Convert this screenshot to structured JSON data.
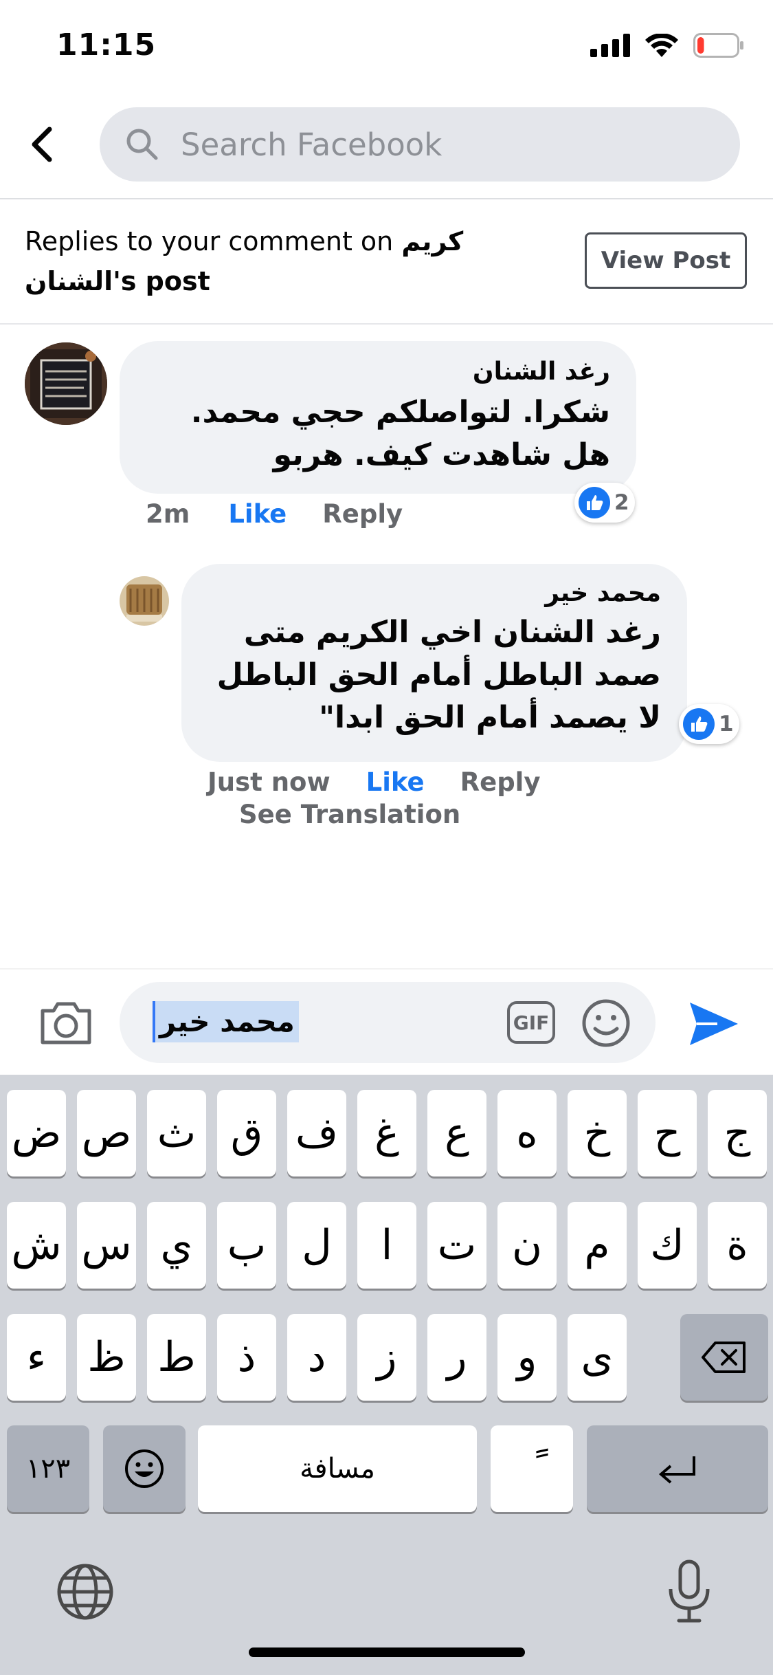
{
  "status_bar": {
    "time": "11:15",
    "battery_level": 0.1,
    "battery_color": "#ff3b30"
  },
  "nav": {
    "search_placeholder": "Search Facebook"
  },
  "header": {
    "title_prefix": "Replies to your comment on",
    "post_owner": "كريم الشنان",
    "title_suffix": "'s post",
    "view_post_label": "View Post"
  },
  "comments": [
    {
      "author": "رغد الشنان",
      "text": "شكرا. لتواصلكم حجي محمد.  هل شاهدت كيف. هربو",
      "time": "2m",
      "like_label": "Like",
      "reply_label": "Reply",
      "reaction_count": "2"
    },
    {
      "author": "محمد خير",
      "text": "رغد الشنان اخي الكريم متى صمد الباطل أمام الحق الباطل لا يصمد أمام الحق ابدا\"",
      "time": "Just now",
      "like_label": "Like",
      "reply_label": "Reply",
      "reaction_count": "1",
      "see_translation": "See Translation"
    }
  ],
  "composer": {
    "text": "محمد خير",
    "gif_label": "GIF"
  },
  "keyboard": {
    "row1": [
      "ض",
      "ص",
      "ث",
      "ق",
      "ف",
      "غ",
      "ع",
      "ه",
      "خ",
      "ح",
      "ج"
    ],
    "row2": [
      "ش",
      "س",
      "ي",
      "ب",
      "ل",
      "ا",
      "ت",
      "ن",
      "م",
      "ك",
      "ة"
    ],
    "row3": [
      "ء",
      "ظ",
      "ط",
      "ذ",
      "د",
      "ز",
      "ر",
      "و",
      "ى"
    ],
    "numbers_label": "١٢٣",
    "space_label": "مسافة",
    "tanween_label": "ً"
  },
  "colors": {
    "accent": "#1877f2",
    "bubble": "#f0f2f5",
    "keyboard_bg": "#d1d4da",
    "text_secondary": "#65676b"
  }
}
